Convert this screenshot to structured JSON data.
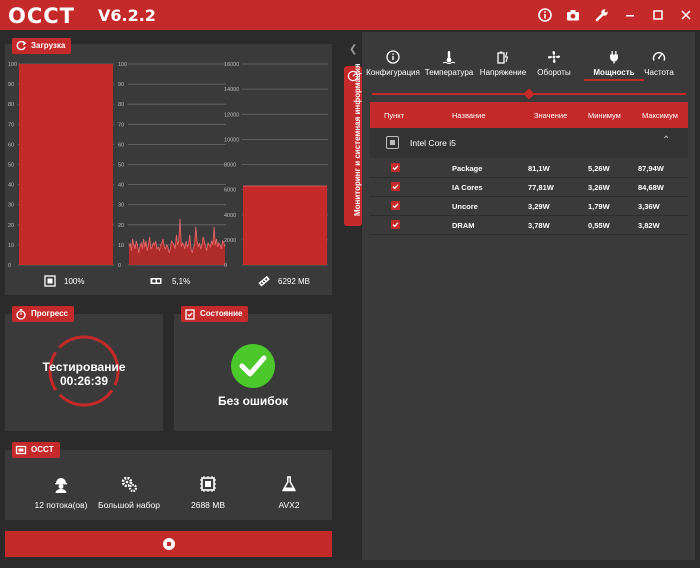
{
  "app": {
    "logo": "OCCT",
    "version": "V6.2.2"
  },
  "toolbar_icons": [
    "info-icon",
    "camera-icon",
    "wrench-icon",
    "minimize-icon",
    "maximize-icon",
    "close-icon"
  ],
  "colors": {
    "accent": "#c42a2a",
    "panel": "#3a3a3a",
    "background": "#2b2b2b",
    "ok_green": "#4cc82c"
  },
  "load_panel": {
    "tag": "Загрузка",
    "charts": [
      {
        "label": "100%",
        "icon": "cpu-icon"
      },
      {
        "label": "5,1%",
        "icon": "gpu-icon"
      },
      {
        "label": "6292 MB",
        "icon": "memory-icon"
      }
    ]
  },
  "chart_data": [
    {
      "type": "bar",
      "title": "",
      "xlabel": "",
      "ylabel": "",
      "ylim": [
        0,
        100
      ],
      "yticks": [
        0,
        10,
        20,
        30,
        40,
        50,
        60,
        70,
        80,
        90,
        100
      ],
      "values": [
        100
      ],
      "grid": true
    },
    {
      "type": "area",
      "title": "",
      "xlabel": "",
      "ylabel": "",
      "ylim": [
        0,
        100
      ],
      "yticks": [
        0,
        10,
        20,
        30,
        40,
        50,
        60,
        70,
        80,
        90,
        100
      ],
      "values": [
        9,
        11,
        7,
        13,
        10,
        8,
        12,
        10,
        6,
        9,
        11,
        8,
        13,
        9,
        12,
        7,
        10,
        14,
        8,
        9,
        11,
        10,
        12,
        8,
        9,
        7,
        10,
        11,
        13,
        9,
        8,
        10,
        9,
        6,
        8,
        12,
        11,
        10,
        8,
        15,
        10,
        12,
        23,
        9,
        11,
        10,
        8,
        12,
        9,
        10,
        15,
        8,
        6,
        9,
        10,
        19,
        12,
        9,
        11,
        8,
        10,
        14,
        12,
        9,
        7,
        11,
        10,
        9,
        12,
        10,
        19,
        10,
        13,
        9,
        11,
        10,
        8,
        12,
        11,
        9
      ],
      "grid": true
    },
    {
      "type": "area",
      "title": "",
      "xlabel": "",
      "ylabel": "",
      "ylim": [
        0,
        16000
      ],
      "yticks": [
        0,
        2000,
        4000,
        6000,
        8000,
        10000,
        12000,
        14000,
        16000
      ],
      "values": [
        6292,
        6292,
        6292,
        6292,
        6292
      ],
      "grid": true
    }
  ],
  "progress_panel": {
    "tag": "Прогресс",
    "status": "Тестирование",
    "elapsed": "00:26:39"
  },
  "state_panel": {
    "tag": "Состояние",
    "status": "Без ошибок"
  },
  "occt_panel": {
    "tag": "OCCT",
    "items": [
      {
        "label": "12 потока(ов)",
        "icon": "worker-icon"
      },
      {
        "label": "Большой набор",
        "icon": "gears-icon"
      },
      {
        "label": "2688 MB",
        "icon": "memory-chip-icon"
      },
      {
        "label": "AVX2",
        "icon": "flask-icon"
      }
    ]
  },
  "side_tab": {
    "label": "Мониторинг и системная информация"
  },
  "monitor": {
    "tabs": [
      {
        "label": "Конфигурация",
        "icon": "info-icon"
      },
      {
        "label": "Температура",
        "icon": "thermometer-icon"
      },
      {
        "label": "Напряжение",
        "icon": "battery-icon"
      },
      {
        "label": "Обороты",
        "icon": "fan-icon"
      },
      {
        "label": "Мощность",
        "icon": "plug-icon"
      },
      {
        "label": "Частота",
        "icon": "gauge-icon"
      }
    ],
    "active_tab": "Мощность",
    "columns": [
      "Пункт",
      "Название",
      "Значение",
      "Минимум",
      "Максимум"
    ],
    "group": "Intel Core i5",
    "rows": [
      {
        "name": "Package",
        "value": "81,1W",
        "min": "5,26W",
        "max": "87,94W",
        "checked": true
      },
      {
        "name": "IA Cores",
        "value": "77,81W",
        "min": "3,26W",
        "max": "84,68W",
        "checked": true
      },
      {
        "name": "Uncore",
        "value": "3,29W",
        "min": "1,79W",
        "max": "3,36W",
        "checked": true
      },
      {
        "name": "DRAM",
        "value": "3,78W",
        "min": "0,55W",
        "max": "3,82W",
        "checked": true
      }
    ]
  }
}
